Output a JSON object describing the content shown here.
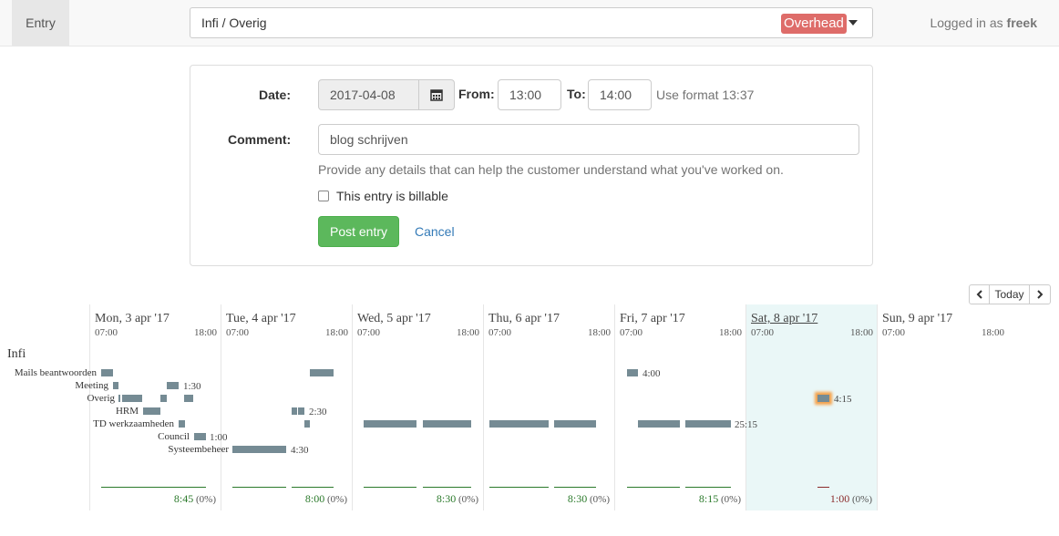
{
  "nav": {
    "entry_tab": "Entry",
    "project_path": "Infi / Overig",
    "project_badge": "Overhead",
    "logged_in_prefix": "Logged in as",
    "username": "freek"
  },
  "form": {
    "date_label": "Date:",
    "date_value": "2017-04-08",
    "from_label": "From:",
    "from_value": "13:00",
    "to_label": "To:",
    "to_value": "14:00",
    "format_hint": "Use format 13:37",
    "comment_label": "Comment:",
    "comment_value": "blog schrijven",
    "help_text": "Provide any details that can help the customer understand what you've worked on.",
    "billable_label": "This entry is billable",
    "billable_checked": false,
    "post_button": "Post entry",
    "cancel_link": "Cancel"
  },
  "calendar": {
    "today_button": "Today",
    "client_label": "Infi",
    "projects": [
      "Mails beantwoorden",
      "Meeting",
      "Overig",
      "HRM",
      "TD werkzaamheden",
      "Council",
      "Systeembeheer"
    ],
    "range_start": "07:00",
    "range_end": "18:00",
    "days": [
      {
        "title": "Mon, 3 apr '17",
        "total": "8:45",
        "pct": "(0%)"
      },
      {
        "title": "Tue, 4 apr '17",
        "total": "8:00",
        "pct": "(0%)"
      },
      {
        "title": "Wed, 5 apr '17",
        "total": "8:30",
        "pct": "(0%)"
      },
      {
        "title": "Thu, 6 apr '17",
        "total": "8:30",
        "pct": "(0%)"
      },
      {
        "title": "Fri, 7 apr '17",
        "total": "8:15",
        "pct": "(0%)"
      },
      {
        "title": "Sat, 8 apr '17",
        "total": "1:00",
        "pct": "(0%)",
        "selected": true
      },
      {
        "title": "Sun, 9 apr '17",
        "total": "",
        "pct": ""
      }
    ],
    "duration_labels": {
      "meeting_mon": "1:30",
      "hrm_tue": "2:30",
      "council_mon": "1:00",
      "systeembeheer_tue": "4:30",
      "mails_fri": "4:00",
      "overig_sat": "4:15",
      "td_fri": "25:15"
    }
  },
  "colors": {
    "badge": "#d9534f",
    "post_button": "#5cb85c",
    "bar": "#758b94",
    "selected_day": "#eaf7f7",
    "total_green": "#2b7a2b"
  }
}
